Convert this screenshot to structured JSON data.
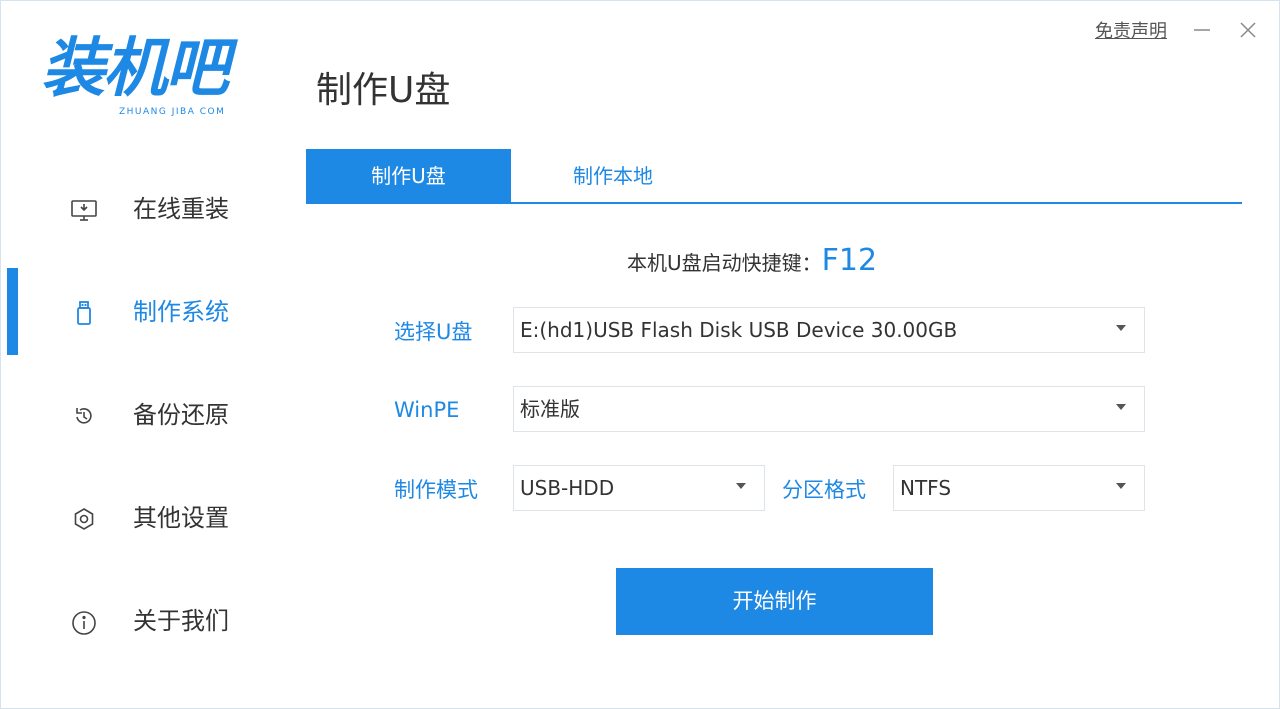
{
  "app": {
    "logo_text": "装机吧",
    "logo_subtext": "ZHUANG JIBA COM",
    "accent_color": "#1e88e5",
    "page_title": "制作U盘"
  },
  "window": {
    "disclaimer_label": "免责声明",
    "minimize_icon": "minimize-icon",
    "close_icon": "close-icon"
  },
  "sidebar": {
    "active_index": 1,
    "items": [
      {
        "label": "在线重装",
        "icon": "monitor-icon"
      },
      {
        "label": "制作系统",
        "icon": "usb-drive-icon"
      },
      {
        "label": "备份还原",
        "icon": "backup-restore-icon"
      },
      {
        "label": "其他设置",
        "icon": "gear-icon"
      },
      {
        "label": "关于我们",
        "icon": "info-icon"
      }
    ]
  },
  "tabs": [
    {
      "label": "制作U盘",
      "active": true
    },
    {
      "label": "制作本地",
      "active": false
    }
  ],
  "hotkey": {
    "label": "本机U盘启动快捷键：",
    "key": "F12"
  },
  "form": {
    "usb_label": "选择U盘",
    "usb_value": "E:(hd1)USB Flash Disk USB Device 30.00GB",
    "winpe_label": "WinPE",
    "winpe_value": "标准版",
    "mode_label": "制作模式",
    "mode_value": "USB-HDD",
    "partition_label": "分区格式",
    "partition_value": "NTFS"
  },
  "actions": {
    "start_label": "开始制作"
  }
}
